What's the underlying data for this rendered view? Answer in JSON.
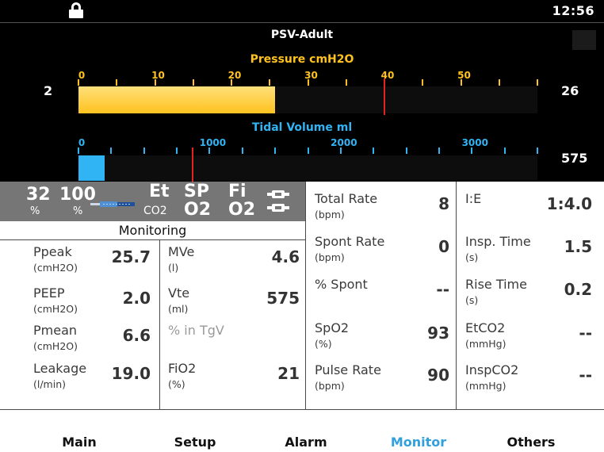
{
  "status": {
    "clock": "12:56",
    "lock_icon": "lock-icon"
  },
  "mode": "PSV-Adult",
  "pressure_gauge": {
    "title": "Pressure cmH2O",
    "left_value": "2",
    "right_value": "26",
    "min": 0,
    "max": 60,
    "tick_labels": [
      "0",
      "10",
      "20",
      "30",
      "40",
      "50"
    ],
    "fill_from": 0,
    "fill_to": 25.7,
    "limit": 40,
    "color": "#ffc21f"
  },
  "volume_gauge": {
    "title": "Tidal Volume ml",
    "right_value": "575",
    "min": 0,
    "max": 3500,
    "tick_labels": [
      "0",
      "1000",
      "2000",
      "3000"
    ],
    "fill_from": 0,
    "fill_to": 200,
    "limit": 870,
    "color": "#31b4f4"
  },
  "indicators": {
    "o2a": "32",
    "o2a_unit": "%",
    "o2b": "100",
    "o2b_unit": "%",
    "et": "Et",
    "co2": "CO2",
    "sp": "SP",
    "o2_1": "O2",
    "fi": "Fi",
    "o2_2": "O2"
  },
  "monitoring_label": "Monitoring",
  "left_params": [
    {
      "name": "Ppeak",
      "unit": "(cmH2O)",
      "value": "25.7"
    },
    {
      "name": "PEEP",
      "unit": "(cmH2O)",
      "value": "2.0"
    },
    {
      "name": "Pmean",
      "unit": "(cmH2O)",
      "value": "6.6"
    },
    {
      "name": "Leakage",
      "unit": "(l/min)",
      "value": "19.0"
    }
  ],
  "mid_params": [
    {
      "name": "MVe",
      "unit": "(l)",
      "value": "4.6"
    },
    {
      "name": "Vte",
      "unit": "(ml)",
      "value": "575"
    },
    {
      "name": "% in TgV",
      "unit": "",
      "value": ""
    },
    {
      "name": "FiO2",
      "unit": "(%)",
      "value": "21"
    }
  ],
  "right_params_a": [
    {
      "name": "Total Rate",
      "unit": "(bpm)",
      "value": "8"
    },
    {
      "name": "Spont Rate",
      "unit": "(bpm)",
      "value": "0"
    },
    {
      "name": "% Spont",
      "unit": "",
      "value": "--"
    },
    {
      "name": "SpO2",
      "unit": "(%)",
      "value": "93"
    },
    {
      "name": "Pulse Rate",
      "unit": "(bpm)",
      "value": "90"
    }
  ],
  "right_params_b": [
    {
      "name": "I:E",
      "unit": "",
      "value": "1:4.0"
    },
    {
      "name": "Insp. Time",
      "unit": "(s)",
      "value": "1.5"
    },
    {
      "name": "Rise Time",
      "unit": "(s)",
      "value": "0.2"
    },
    {
      "name": "EtCO2",
      "unit": "(mmHg)",
      "value": "--"
    },
    {
      "name": "InspCO2",
      "unit": "(mmHg)",
      "value": "--"
    }
  ],
  "nav": [
    "Main",
    "Setup",
    "Alarm",
    "Monitor",
    "Others"
  ],
  "nav_active": "Monitor"
}
